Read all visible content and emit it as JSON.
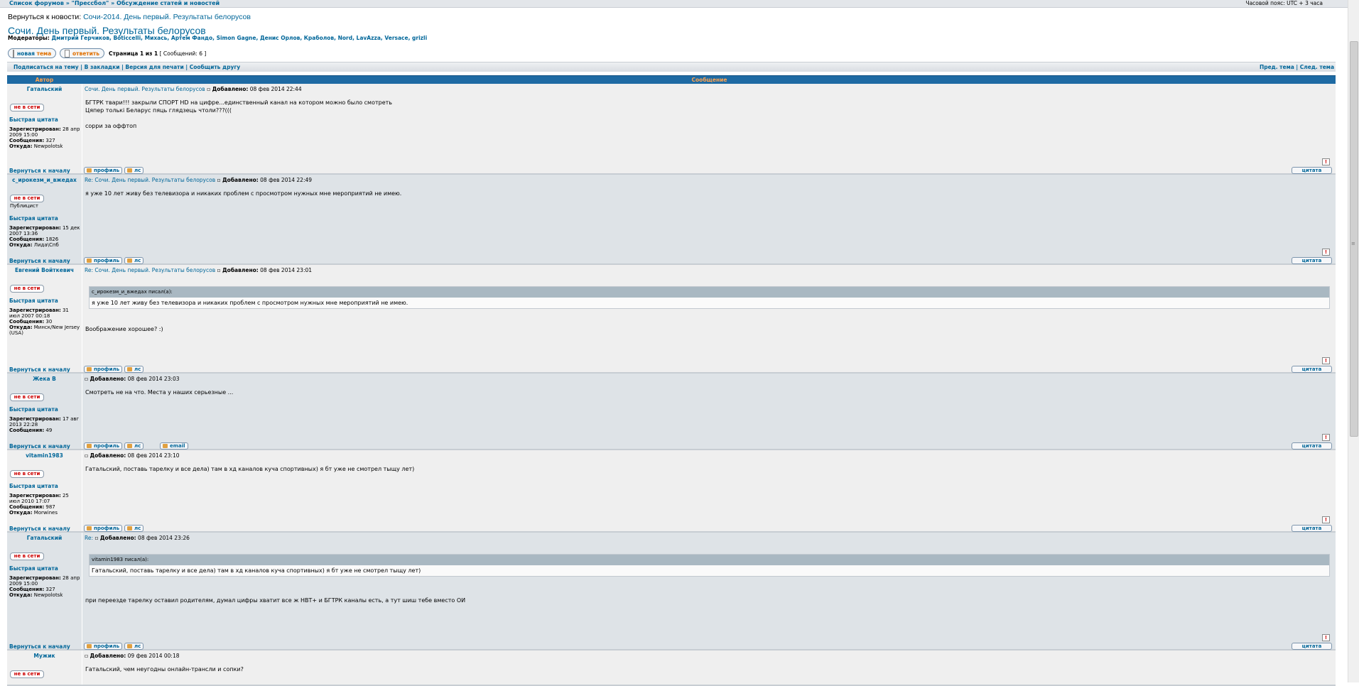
{
  "breadcrumb": {
    "text": "Список форумов » \"Прессбол\" » Обсуждение статей и новостей"
  },
  "timezone": "Часовой пояс: UTC + 3 часа",
  "news": {
    "prefix": "Вернуться к новости: ",
    "link": "Сочи-2014. День первый. Результаты белорусов"
  },
  "topic_title": "Сочи. День первый. Результаты белорусов",
  "moderators": {
    "label": "Модераторы: ",
    "names": "Дмитрий Герчиков, Boticcelli, Михась, Артем Фандо, Simon Gagne, Денис Орлов, Краболов, Nord, LavAzza, Versace, grizli"
  },
  "buttons": {
    "new_topic_a": "новая",
    "new_topic_b": "тема",
    "reply": "ответить"
  },
  "page_info": {
    "page": "Страница 1 из 1",
    "count": "[ Сообщений: 6 ]"
  },
  "action_bar": {
    "left": "Подписаться на тему | В закладки | Версия для печати | Сообщить другу",
    "right": "Пред. тема | След. тема"
  },
  "table_header": {
    "author": "Автор",
    "message": "Сообщение"
  },
  "labels": {
    "offline": "не в сети",
    "quick_quote": "Быстрая цитата",
    "back_to_top": "Вернуться к началу",
    "profile": "профиль",
    "pm": "лс",
    "email": "email",
    "quote": "цитата",
    "report": "!",
    "added": "Добавлено:"
  },
  "posts": [
    {
      "author": "Гатальский",
      "subject": "Сочи. День первый. Результаты белорусов",
      "date": "08 фев 2014 22:44",
      "rank": "",
      "info": [
        "Зарегистрирован: 28 апр 2009 15:00",
        "Сообщения: 327",
        "Откуда: Newpolotsk"
      ],
      "body": [
        "БГТРК твари!!! закрыли СПОРТ HD на цифре...единственный канал на котором можно было смотреть",
        "Цяпер толькi Беларус пяць глядзець чтоли???(((",
        "",
        "сорри за оффтоп"
      ],
      "quote": null,
      "after": ""
    },
    {
      "author": "с_ирокезм_и_вжедах",
      "subject": "Re: Сочи. День первый. Результаты белорусов",
      "date": "08 фев 2014 22:49",
      "rank": "Публицист",
      "info": [
        "Зарегистрирован: 15 дек 2007 13:36",
        "Сообщения: 1826",
        "Откуда: Лида\\Спб"
      ],
      "body": [
        "я уже 10 лет живу без телевизора и никаких проблем с просмотром нужных мне мероприятий не имею."
      ],
      "quote": null,
      "after": ""
    },
    {
      "author": "Евгений Войткевич",
      "subject": "Re: Сочи. День первый. Результаты белорусов",
      "date": "08 фев 2014 23:01",
      "rank": "",
      "info": [
        "Зарегистрирован: 31 июл 2007 00:18",
        "Сообщения: 30",
        "Откуда: Минск/New Jersey (USA)"
      ],
      "body": [],
      "quote": {
        "head": "с_ирокезм_и_вжедах писал(а):",
        "text": "я уже 10 лет живу без телевизора и никаких проблем с просмотром нужных мне мероприятий не имею."
      },
      "after": "Воображение хорошее? :)"
    },
    {
      "author": "Жека В",
      "subject": "",
      "date": "08 фев 2014 23:03",
      "rank": "",
      "info": [
        "Зарегистрирован: 17 авг 2013 22:28",
        "Сообщения: 49"
      ],
      "body": [
        "Смотреть не на что. Места у наших серьезные ..."
      ],
      "quote": null,
      "after": ""
    },
    {
      "author": "vitamin1983",
      "subject": "",
      "date": "08 фев 2014 23:10",
      "rank": "",
      "info": [
        "Зарегистрирован: 25 июл 2010 17:07",
        "Сообщения: 987",
        "Откуда: Morwines"
      ],
      "body": [
        "Гатальский, поставь тарелку и все дела) там в хд каналов куча спортивных) я бт уже не смотрел тыщу лет)"
      ],
      "quote": null,
      "after": ""
    },
    {
      "author": "Гатальский",
      "subject": "Re:",
      "date": "08 фев 2014 23:26",
      "rank": "",
      "info": [
        "Зарегистрирован: 28 апр 2009 15:00",
        "Сообщения: 327",
        "Откуда: Newpolotsk"
      ],
      "body": [],
      "quote": {
        "head": "vitamin1983 писал(а):",
        "text": "Гатальский, поставь тарелку и все дела) там в хд каналов куча спортивных) я бт уже не смотрел тыщу лет)"
      },
      "after": "при переезде тарелку оставил родителям, думал цифры хватит все ж НВТ+ и БГТРК каналы есть, а тут шиш тебе вместо ОИ"
    },
    {
      "author": "Мужик",
      "subject": "",
      "date": "09 фев 2014 00:18",
      "rank": "",
      "info": [],
      "body": [
        "Гатальский, чем неугодны онлайн-трансли и сопки?"
      ],
      "quote": null,
      "after": ""
    }
  ]
}
